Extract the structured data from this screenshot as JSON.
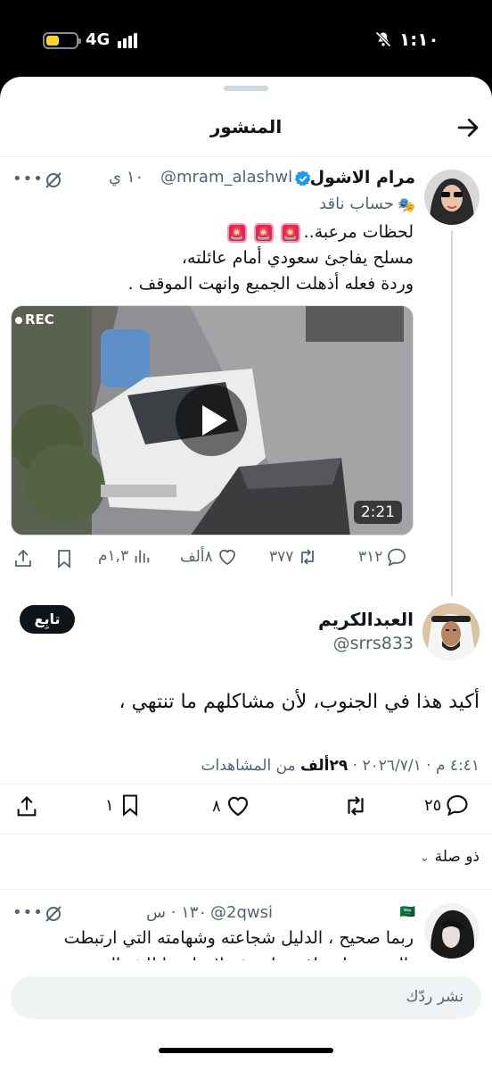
{
  "status_bar": {
    "time": "١:١٠",
    "network": "4G"
  },
  "header": {
    "title": "المنشور"
  },
  "tweet": {
    "author_name": "مرام الاشول",
    "handle": "@mram_alashwl",
    "time": "١٠ ي",
    "label": "حساب ناقد",
    "text_lines": [
      "لحظات مرعبة..",
      "مسلح يفاجئ سعودي أمام عائلته،",
      "وردة فعله أذهلت الجميع وانهت الموقف ."
    ],
    "video": {
      "rec_label": "REC",
      "duration": "2:21"
    },
    "actions": {
      "replies": "٣١٢",
      "reposts": "٣٧٧",
      "likes": "٨ألف",
      "views": "١,٣م"
    }
  },
  "main_tweet": {
    "author_name": "العبدالكريم",
    "handle": "@srrs833",
    "follow_label": "تابِع",
    "text": "أكيد هذا في الجنوب، لأن مشاكلهم ما تنتهي ،",
    "meta_time": "٤:٤١ م · ٢٠٢٦/٧/١ · ",
    "meta_views_count": "٢٩ألف",
    "meta_views_label": " من المشاهدات",
    "actions": {
      "replies": "٢٥",
      "reposts": "",
      "likes": "٨",
      "bookmarks": "١"
    }
  },
  "sort": {
    "label": "ذو صلة"
  },
  "reply": {
    "flag": "🇸🇦",
    "handle": "@2qwsi",
    "time": "١٣٠ · س",
    "text_lines": [
      "ربما صحيح ، الدليل شجاعته وشهامته التي ارتبطت",
      "بالجنوب باعتراف منك ، ثم لان اهجنا للشمال رح"
    ]
  },
  "reply_bar": {
    "placeholder": "نشر ردّك"
  },
  "colors": {
    "accent": "#1d9bf0",
    "text": "#0f1419",
    "secondary": "#536471",
    "background": "#ffffff"
  }
}
